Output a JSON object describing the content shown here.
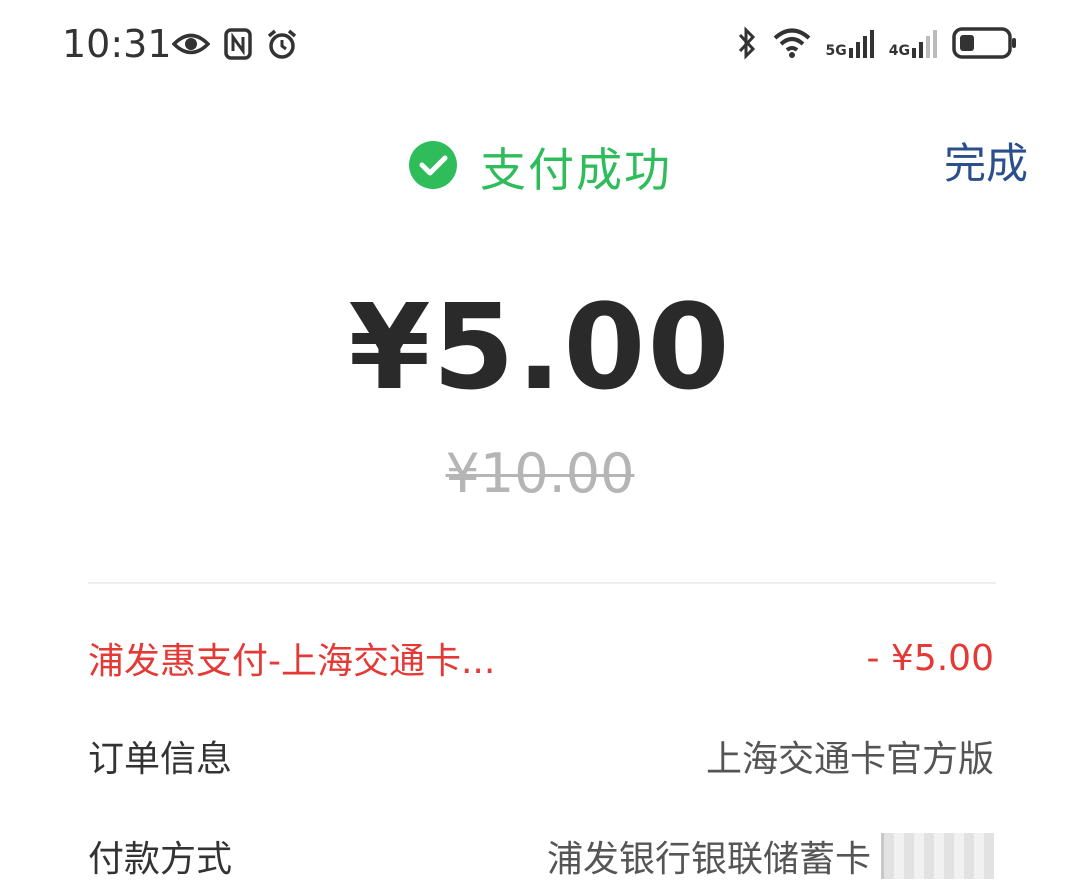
{
  "status_bar": {
    "time": "10:31",
    "left_icons": [
      "eye-icon",
      "nfc-icon",
      "alarm-icon"
    ],
    "right_icons": [
      "bluetooth-icon",
      "wifi-icon",
      "signal-5g-icon",
      "signal-4g-icon",
      "battery-icon"
    ],
    "network_5g": "5G",
    "network_4g": "4G"
  },
  "header": {
    "status_text": "支付成功",
    "done_label": "完成",
    "success_color": "#2fbd5b",
    "done_color": "#2b4e8c"
  },
  "payment": {
    "amount": "¥5.00",
    "original_amount": "¥10.00"
  },
  "details": {
    "discount": {
      "label": "浦发惠支付-上海交通卡...",
      "value": "- ¥5.00",
      "color": "#e53935"
    },
    "order": {
      "label": "订单信息",
      "value": "上海交通卡官方版"
    },
    "payment_method": {
      "label": "付款方式",
      "value": "浦发银行银联储蓄卡"
    }
  }
}
